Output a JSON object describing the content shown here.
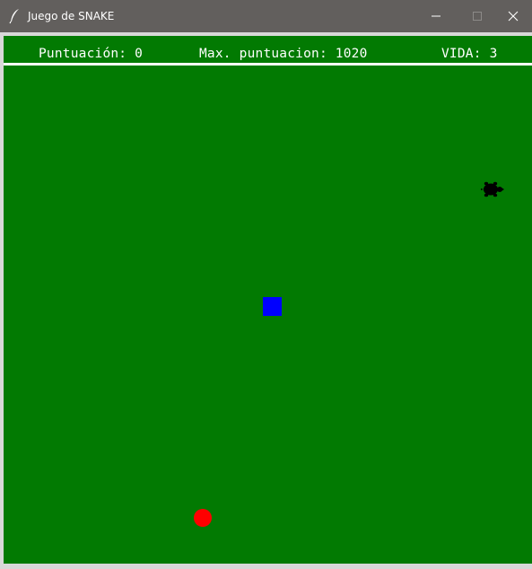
{
  "window": {
    "title": "Juego de SNAKE",
    "app_icon": "feather-icon",
    "controls": [
      "minimize-icon",
      "maximize-icon",
      "close-icon"
    ]
  },
  "hud": {
    "score_text": "Puntuación: 0",
    "high_score_text": "Max. puntuacion: 1020",
    "lives_text": "VIDA: 3"
  },
  "game": {
    "snake_head_color": "#0000ff",
    "food_color": "#ff0000",
    "turtle_icon": "turtle-icon",
    "background_color": "#027a02",
    "divider_color": "#ffffff"
  }
}
